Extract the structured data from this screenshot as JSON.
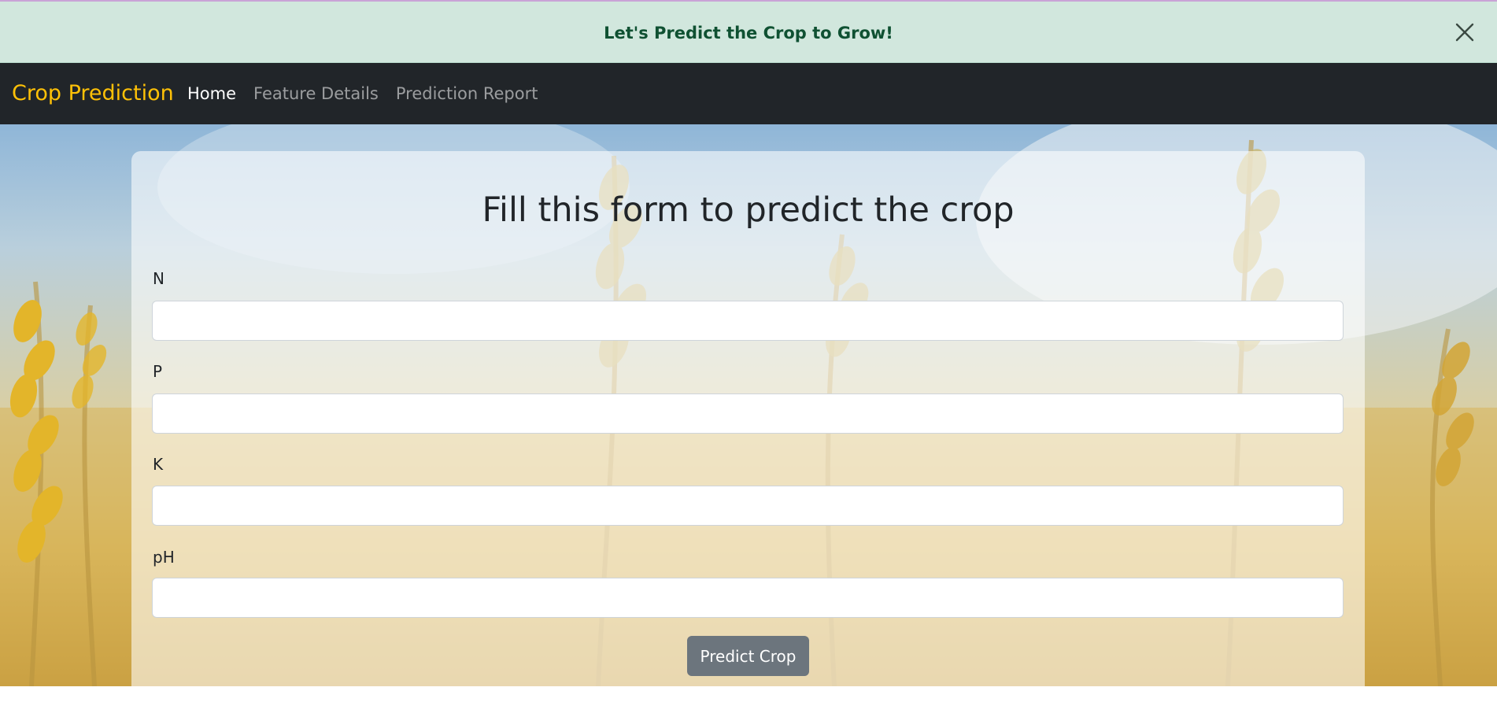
{
  "alert": {
    "message": "Let's Predict the Crop to Grow!",
    "close_icon": "close-icon"
  },
  "navbar": {
    "brand": "Crop Prediction",
    "links": [
      {
        "label": "Home",
        "active": true
      },
      {
        "label": "Feature Details",
        "active": false
      },
      {
        "label": "Prediction Report",
        "active": false
      }
    ]
  },
  "form": {
    "title": "Fill this form to predict the crop",
    "fields": [
      {
        "label": "N",
        "value": "",
        "placeholder": ""
      },
      {
        "label": "P",
        "value": "",
        "placeholder": ""
      },
      {
        "label": "K",
        "value": "",
        "placeholder": ""
      },
      {
        "label": "pH",
        "value": "",
        "placeholder": ""
      }
    ],
    "submit_label": "Predict Crop"
  },
  "colors": {
    "alert_bg": "#d1e7dd",
    "alert_text": "#0f5132",
    "navbar_bg": "#212529",
    "brand": "#ffc107",
    "button_bg": "#6c757d"
  }
}
